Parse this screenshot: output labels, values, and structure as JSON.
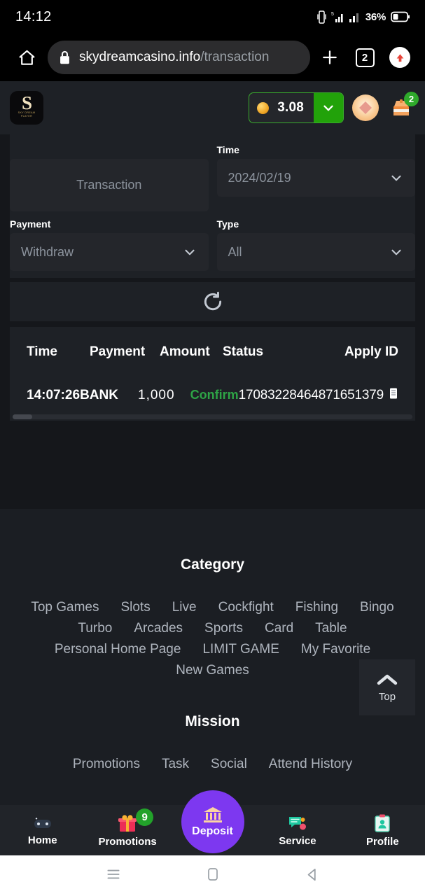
{
  "status_bar": {
    "clock": "14:12",
    "battery_pct": "36%",
    "icons": [
      "vibrate-icon",
      "signal-icon",
      "signal-bars-icon",
      "battery-icon"
    ]
  },
  "browser": {
    "home_icon": "home-icon",
    "lock_icon": "lock-icon",
    "url_host": "skydreamcasino.info",
    "url_path": "/transaction",
    "new_tab_icon": "plus-icon",
    "tab_count": "2",
    "update_icon": "arrow-up-icon"
  },
  "site_header": {
    "logo_letter": "S",
    "logo_subtitle": "SKY DREAM\nPLAYER",
    "coin_icon": "coin-icon",
    "balance": "3.08",
    "balance_caret_icon": "chevron-down-icon",
    "avatar_icon": "avatar-icon",
    "mailbox_icon": "mailbox-icon",
    "mailbox_badge": "2"
  },
  "filters": {
    "page_title": "Transaction",
    "time_label": "Time",
    "time_value": "2024/02/19",
    "payment_label": "Payment",
    "payment_value": "Withdraw",
    "type_label": "Type",
    "type_value": "All",
    "caret_icon": "chevron-down-icon"
  },
  "refresh": {
    "icon": "refresh-icon"
  },
  "table": {
    "columns": [
      "Time",
      "Payment",
      "Amount",
      "Status",
      "Apply ID"
    ],
    "rows": [
      {
        "time": "14:07:26",
        "payment": "BANK",
        "amount": "1,000",
        "status": "Confirm",
        "status_color": "#2ea446",
        "apply_id": "17083228464871651379",
        "copy_icon": "copy-icon"
      }
    ]
  },
  "footer": {
    "category_title": "Category",
    "category_links": [
      "Top Games",
      "Slots",
      "Live",
      "Cockfight",
      "Fishing",
      "Bingo",
      "Turbo",
      "Arcades",
      "Sports",
      "Card",
      "Table",
      "Personal Home Page",
      "LIMIT GAME",
      "My Favorite",
      "New Games"
    ],
    "mission_title": "Mission",
    "mission_links": [
      "Promotions",
      "Task",
      "Social",
      "Attend History"
    ],
    "top_button": {
      "label": "Top",
      "icon": "chevron-up-icon"
    }
  },
  "bottom_nav": {
    "items": [
      {
        "label": "Home",
        "icon": "gamepad-icon",
        "badge": ""
      },
      {
        "label": "Promotions",
        "icon": "gift-icon",
        "badge": "9"
      },
      {
        "label": "Service",
        "icon": "chat-icon",
        "badge": ""
      },
      {
        "label": "Profile",
        "icon": "profile-icon",
        "badge": ""
      }
    ],
    "deposit": {
      "label": "Deposit",
      "icon": "bank-icon",
      "color": "#7d38f0"
    }
  },
  "android_nav": {
    "recents_icon": "menu-icon",
    "home_icon": "square-icon",
    "back_icon": "triangle-back-icon"
  }
}
